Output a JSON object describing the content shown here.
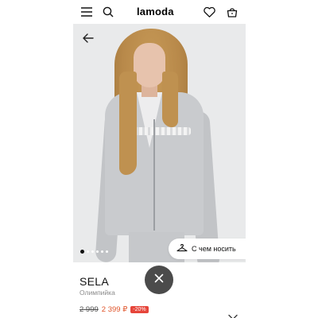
{
  "header": {
    "logo": "lamoda",
    "icons": [
      "menu-icon",
      "search-icon",
      "heart-icon",
      "bag-icon"
    ]
  },
  "gallery": {
    "image_count": 6,
    "active_index": 0,
    "wear_with_label": "С чем носить"
  },
  "product": {
    "brand": "SELA",
    "category": "Олимпийка",
    "old_price": "2 999",
    "new_price": "2 399 ₽",
    "discount": "-20%"
  },
  "colors": {
    "accent_price": "#e0552b",
    "discount_bg": "#e6453a",
    "close_button_bg": "#4b4b4b"
  }
}
